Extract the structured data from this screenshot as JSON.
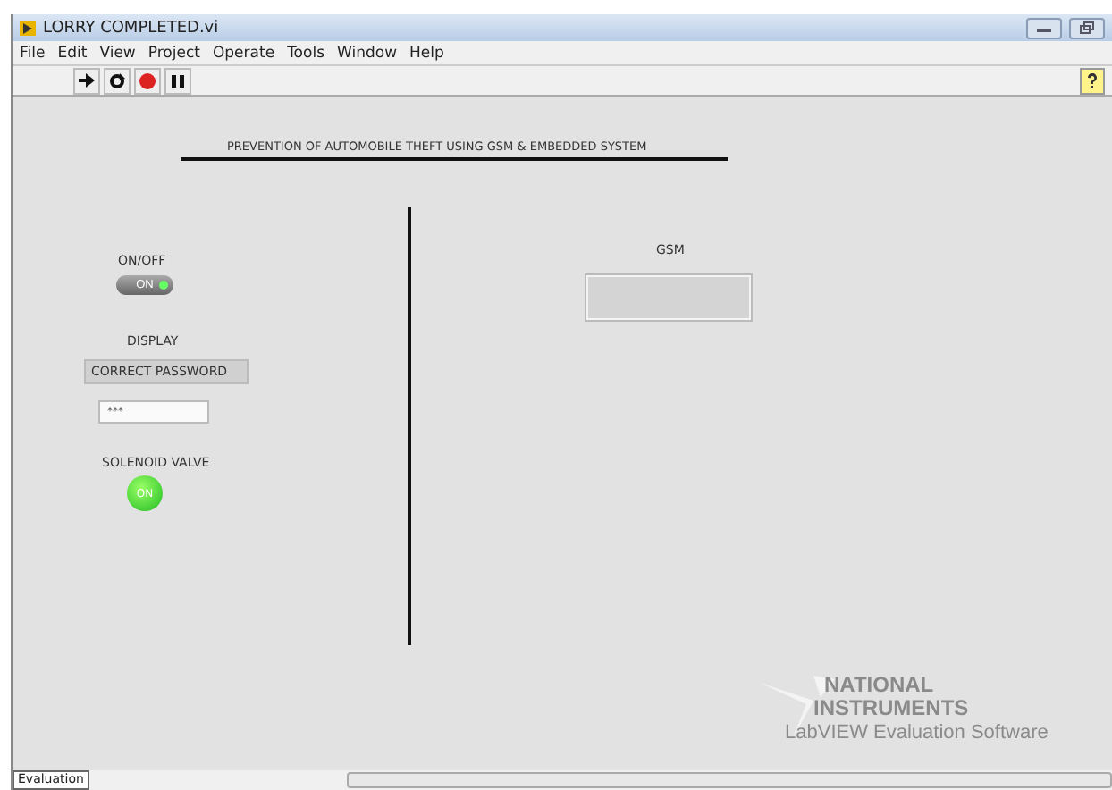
{
  "window": {
    "title": "LORRY COMPLETED.vi"
  },
  "menu": [
    "File",
    "Edit",
    "View",
    "Project",
    "Operate",
    "Tools",
    "Window",
    "Help"
  ],
  "panel": {
    "heading": "PREVENTION OF AUTOMOBILE THEFT USING GSM & EMBEDDED SYSTEM",
    "switch": {
      "label": "ON/OFF",
      "text": "ON",
      "on": true
    },
    "display": {
      "label": "DISPLAY",
      "value": "CORRECT PASSWORD"
    },
    "password": {
      "value": "***"
    },
    "led": {
      "label": "SOLENOID VALVE",
      "text": "ON",
      "on": true
    },
    "gsm": {
      "label": "GSM"
    }
  },
  "watermark": {
    "line_1": "NATIONAL",
    "line_2": "INSTRUMENTS",
    "line_3": "LabVIEW Evaluation Software"
  },
  "bottom_tab": "Evaluation"
}
